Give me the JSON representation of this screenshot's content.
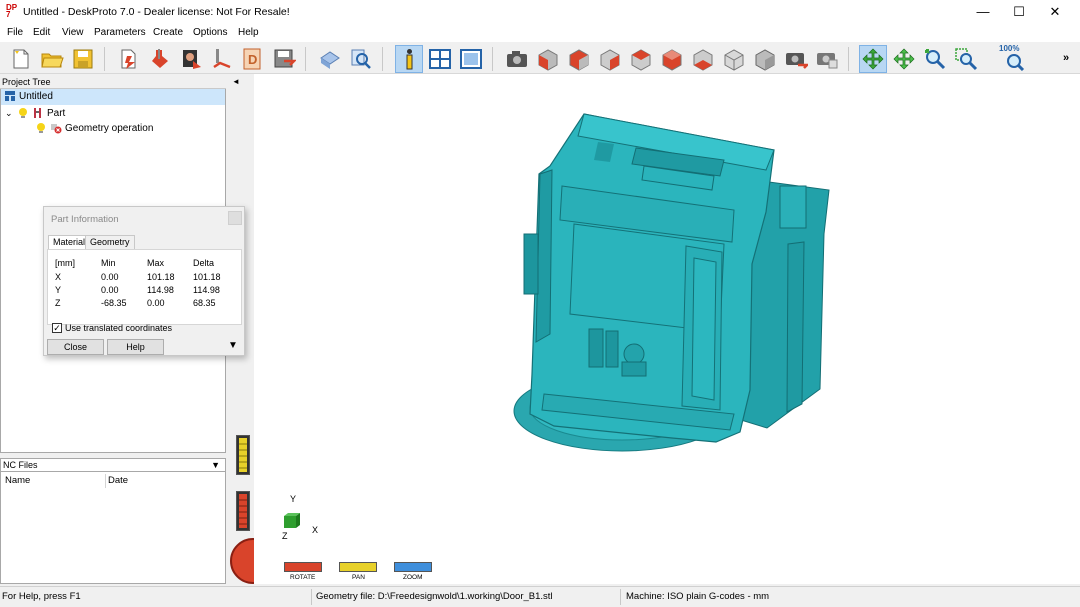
{
  "window": {
    "title": "Untitled - DeskProto 7.0 - Dealer license: Not For Resale!",
    "minimize": "—",
    "maximize": "☐",
    "close": "✕"
  },
  "menu": [
    "File",
    "Edit",
    "View",
    "Parameters",
    "Create",
    "Options",
    "Help"
  ],
  "toolbar": {
    "zoom_badge": "100%",
    "overflow": "»",
    "icons": [
      "new-project-icon",
      "open-project-icon",
      "save-project-icon",
      "part-wizard-icon",
      "operation-wizard-icon",
      "bitmap-wizard-icon",
      "toolpath-wizard-icon",
      "drawing-icon",
      "save-as-icon",
      "part-icon",
      "inspect-icon",
      "info-icon",
      "window-split-icon",
      "layout-icon",
      "camera-view-icon",
      "view-front-icon",
      "view-back-icon",
      "view-left-icon",
      "view-right-icon",
      "view-top-icon",
      "view-bottom-icon",
      "view-iso-icon",
      "view-iso2-icon",
      "snapshot-icon",
      "copy-view-icon",
      "rotate-tool-icon",
      "pan-tool-icon",
      "zoom-tool-icon",
      "zoom-window-icon",
      "zoom-100-icon"
    ]
  },
  "project_tree": {
    "header": "Project Tree",
    "root": "Untitled",
    "part": "Part",
    "operation": "Geometry operation"
  },
  "nc_files": {
    "header": "NC Files",
    "columns": [
      "Name",
      "Date"
    ]
  },
  "dialog": {
    "title": "Part Information",
    "tabs": [
      "Material",
      "Geometry"
    ],
    "table": {
      "headers": [
        "[mm]",
        "Min",
        "Max",
        "Delta"
      ],
      "rows": [
        [
          "X",
          "0.00",
          "101.18",
          "101.18"
        ],
        [
          "Y",
          "0.00",
          "114.98",
          "114.98"
        ],
        [
          "Z",
          "-68.35",
          "0.00",
          "68.35"
        ]
      ]
    },
    "checkbox_label": "Use translated coordinates",
    "checkbox_checked": true,
    "buttons": [
      "Close",
      "Help"
    ]
  },
  "viewport": {
    "model_color": "#2bb5bd",
    "axis_labels": {
      "x": "X",
      "y": "Y",
      "z": "Z"
    },
    "controls": [
      "ROTATE",
      "PAN",
      "ZOOM"
    ],
    "collapse_arrow": "◄"
  },
  "statusbar": {
    "help": "For Help, press F1",
    "geometry": "Geometry file: D:\\Freedesignwold\\1.working\\Door_B1.stl",
    "machine": "Machine: ISO plain G-codes - mm"
  }
}
